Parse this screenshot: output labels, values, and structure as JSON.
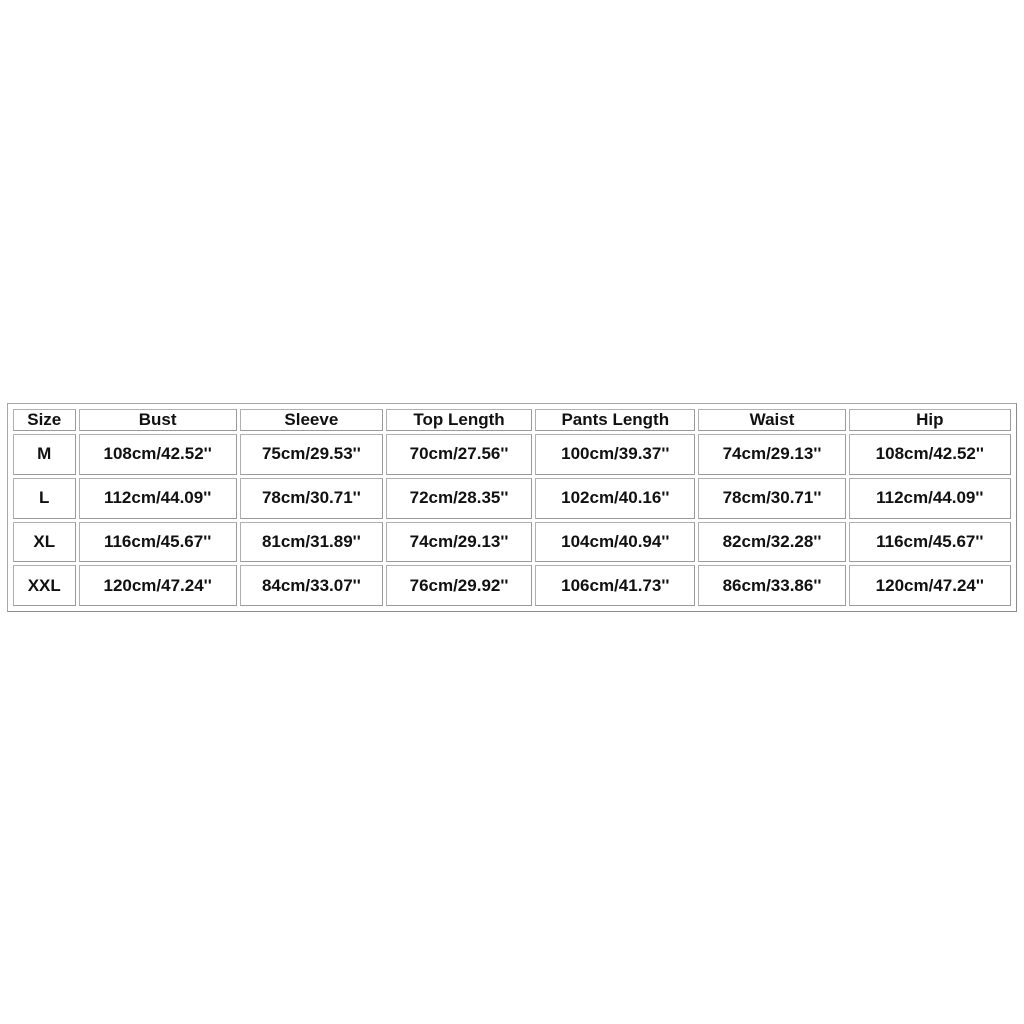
{
  "size_chart": {
    "headers": [
      "Size",
      "Bust",
      "Sleeve",
      "Top Length",
      "Pants Length",
      "Waist",
      "Hip"
    ],
    "rows": [
      [
        "M",
        "108cm/42.52''",
        "75cm/29.53''",
        "70cm/27.56''",
        "100cm/39.37''",
        "74cm/29.13''",
        "108cm/42.52''"
      ],
      [
        "L",
        "112cm/44.09''",
        "78cm/30.71''",
        "72cm/28.35''",
        "102cm/40.16''",
        "78cm/30.71''",
        "112cm/44.09''"
      ],
      [
        "XL",
        "116cm/45.67''",
        "81cm/31.89''",
        "74cm/29.13''",
        "104cm/40.94''",
        "82cm/32.28''",
        "116cm/45.67''"
      ],
      [
        "XXL",
        "120cm/47.24''",
        "84cm/33.07''",
        "76cm/29.92''",
        "106cm/41.73''",
        "86cm/33.86''",
        "120cm/47.24''"
      ]
    ]
  },
  "colors": {
    "background": "#ffffff",
    "border": "#9a9a9a",
    "text": "#111111"
  }
}
